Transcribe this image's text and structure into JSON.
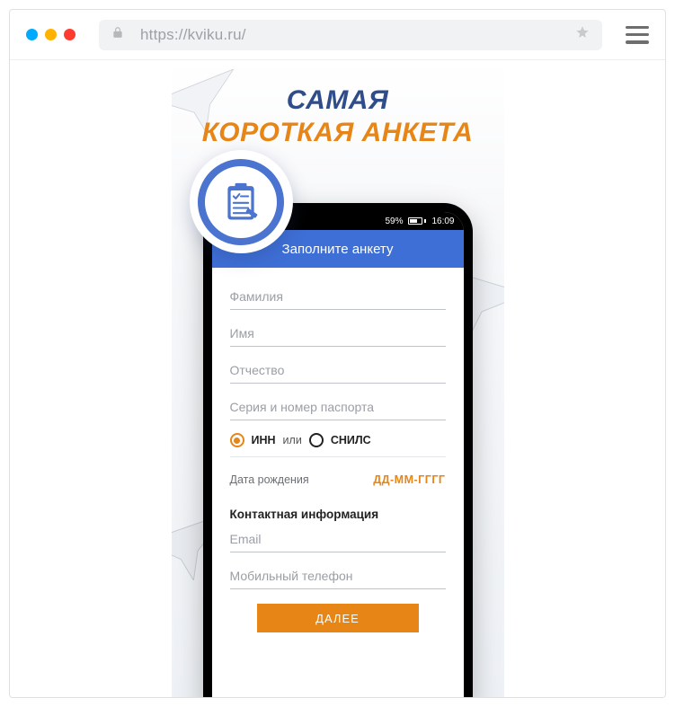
{
  "browser": {
    "url": "https://kviku.ru/"
  },
  "headline": {
    "line1": "САМАЯ",
    "line2": "КОРОТКАЯ АНКЕТА"
  },
  "phone_status": {
    "battery_pct": "59%",
    "time": "16:09"
  },
  "form": {
    "header": "Заполните анкету",
    "placeholders": {
      "surname": "Фамилия",
      "name": "Имя",
      "patronymic": "Отчество",
      "passport": "Серия и номер паспорта",
      "email": "Email",
      "phone": "Мобильный телефон"
    },
    "radio": {
      "inn": "ИНН",
      "sep": "или",
      "snils": "СНИЛС"
    },
    "dob_label": "Дата рождения",
    "dob_placeholder": "ДД-ММ-ГГГГ",
    "contact_section": "Контактная информация",
    "next": "ДАЛЕЕ"
  }
}
